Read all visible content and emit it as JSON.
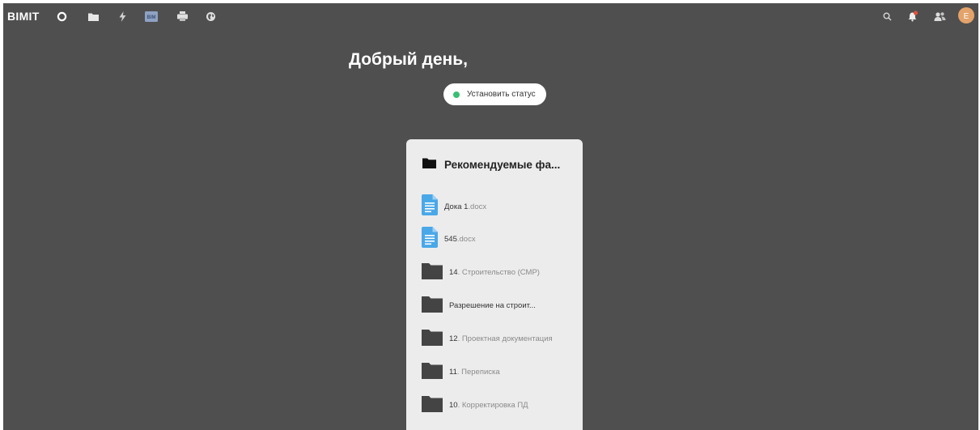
{
  "app": {
    "logo": "BIMIT"
  },
  "topbar": {
    "nav_icons": [
      "circle-icon",
      "folder-icon",
      "lightning-icon",
      "bim-icon",
      "printer-icon",
      "globe-icon"
    ],
    "bim_badge": "BIM",
    "right_icons": [
      "search-icon",
      "notification-bell-icon",
      "users-icon"
    ],
    "avatar_letter": "E",
    "avatar_color": "#e3a36b",
    "bell_badge_color": "#e2503b"
  },
  "main": {
    "greeting": "Добрый день,",
    "status_button_label": "Установить статус",
    "status_color": "#3cbe72"
  },
  "recommended": {
    "title": "Рекомендуемые фа...",
    "items": [
      {
        "type": "doc",
        "name": "Дока 1",
        "ext": ".docx"
      },
      {
        "type": "doc",
        "name": "545",
        "ext": ".docx"
      },
      {
        "type": "folder",
        "name": "14",
        "ext": ". Строительство (СМР)"
      },
      {
        "type": "folder",
        "name": "Разрешение на строит...",
        "ext": ""
      },
      {
        "type": "folder",
        "name": "12",
        "ext": ". Проектная документация"
      },
      {
        "type": "folder",
        "name": "11",
        "ext": ". Переписка"
      },
      {
        "type": "folder",
        "name": "10",
        "ext": ". Корректировка ПД"
      }
    ]
  },
  "colors": {
    "background": "#4f4f4f",
    "card": "#ececec",
    "doc_icon": "#4aa8e8",
    "folder_icon": "#444444"
  }
}
